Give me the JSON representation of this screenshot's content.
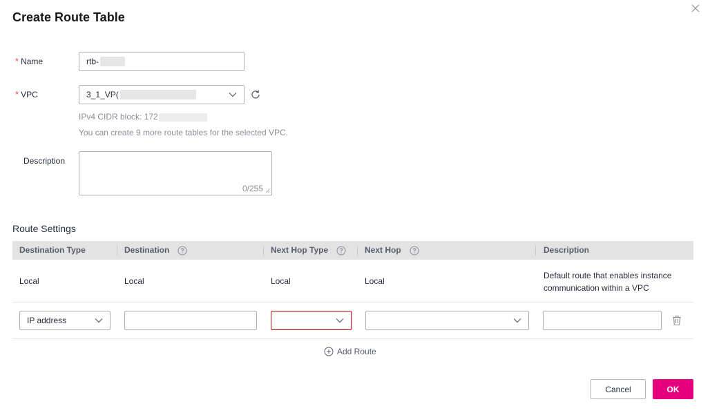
{
  "dialog": {
    "title": "Create Route Table"
  },
  "form": {
    "name_label": "Name",
    "name_value": "rtb-",
    "vpc_label": "VPC",
    "vpc_value": "3_1_VP(",
    "cidr_hint": "IPv4 CIDR block: 172",
    "quota_hint": "You can create 9 more route tables for the selected VPC.",
    "description_label": "Description",
    "description_counter": "0/255"
  },
  "route_settings": {
    "title": "Route Settings",
    "columns": [
      "Destination Type",
      "Destination",
      "Next Hop Type",
      "Next Hop",
      "Description"
    ],
    "rows": [
      {
        "destination_type": "Local",
        "destination": "Local",
        "next_hop_type": "Local",
        "next_hop": "Local",
        "description": "Default route that enables instance communication within a VPC"
      }
    ],
    "edit_row": {
      "destination_type": "IP address",
      "destination": "",
      "next_hop_type": "",
      "next_hop": "",
      "description": ""
    },
    "add_route_label": "Add Route"
  },
  "footer": {
    "cancel_label": "Cancel",
    "ok_label": "OK"
  },
  "colors": {
    "primary": "#e6007e",
    "required": "#e84d4d",
    "error_border": "#c7000b",
    "header_bg": "#e3e3e3"
  },
  "icons": [
    "close-icon",
    "refresh-icon",
    "chevron-down-icon",
    "help-icon",
    "trash-icon",
    "add-circle-icon",
    "resize-grip-icon"
  ]
}
